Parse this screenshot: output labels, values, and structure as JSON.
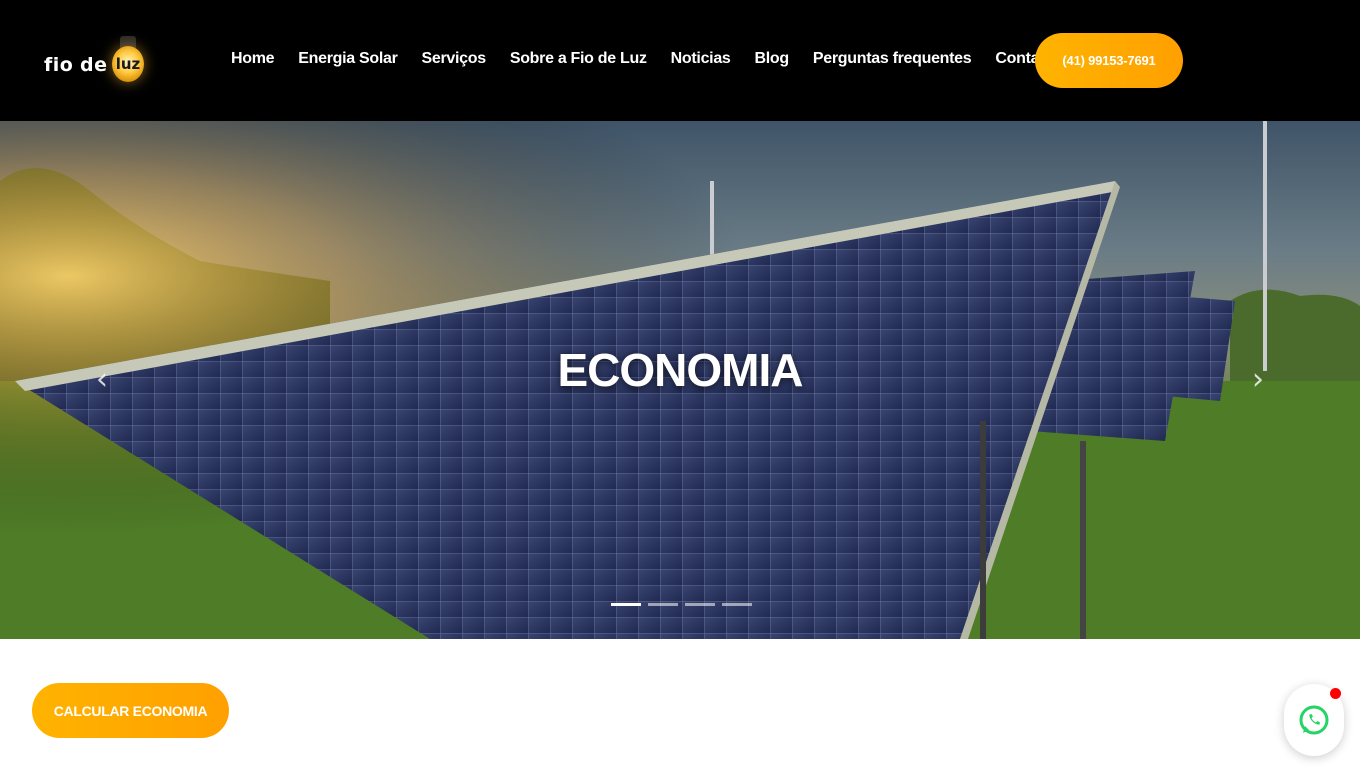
{
  "logo": {
    "word1": "fio",
    "word2": "de",
    "word3": "luz"
  },
  "nav": {
    "items": [
      {
        "label": "Home"
      },
      {
        "label": "Energia Solar"
      },
      {
        "label": "Serviços"
      },
      {
        "label": "Sobre a Fio de Luz"
      },
      {
        "label": "Noticias"
      },
      {
        "label": "Blog"
      },
      {
        "label": "Perguntas frequentes"
      },
      {
        "label": "Contato"
      }
    ]
  },
  "header": {
    "phone_label": "(41) 99153-7691"
  },
  "hero": {
    "title": "ECONOMIA",
    "prev_icon": "chevron-left-icon",
    "next_icon": "chevron-right-icon",
    "slide_count": 4,
    "active_slide": 1
  },
  "calc": {
    "label": "CALCULAR ECONOMIA"
  },
  "whatsapp": {
    "icon": "whatsapp-icon",
    "notification": true
  },
  "colors": {
    "accent": "#ffa800",
    "header_bg": "#000000",
    "whatsapp": "#25d366",
    "notification": "#ff0000"
  }
}
